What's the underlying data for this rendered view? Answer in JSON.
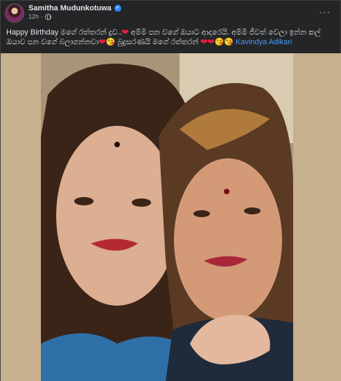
{
  "post": {
    "author": "Samitha Mudunkotuwa",
    "verified_badge": "✓",
    "time": "12h",
    "dot": "·",
    "more_icon": "···",
    "caption": {
      "part1": "Happy Birthday මගේ රත්තරන් දුව..",
      "part2": " අම්මී පන වගේ ඔයාට ආදරෙයි. අම්මි ජීවත් වෙලා ඉන්න කල් ඔයාව පන වගේ බලාගන්නවා",
      "part3": " බුදුසරණයි මගේ රත්තරන් ",
      "tag": "Kavindya Adikari",
      "heart": "❤",
      "kiss_emoji": "😘"
    }
  },
  "colors": {
    "background": "#242526",
    "text": "#e4e6eb",
    "muted": "#b0b3b8",
    "link": "#4599ff",
    "heart": "#e41e3f",
    "media_backdrop": "#c7b08e"
  }
}
